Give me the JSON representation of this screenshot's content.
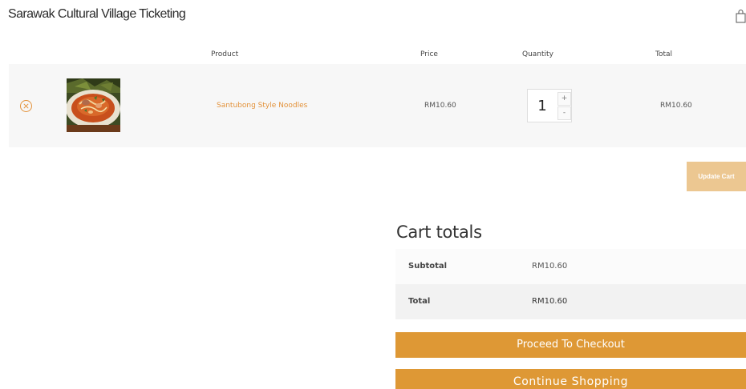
{
  "header": {
    "site_title": "Sarawak Cultural Village Ticketing",
    "cart_icon": "shopping-bag-icon"
  },
  "cart_table": {
    "columns": [
      "Product",
      "Price",
      "Quantity",
      "Total"
    ],
    "items": [
      {
        "name": "Santubong Style Noodles",
        "price": "RM10.60",
        "quantity": "1",
        "total": "RM10.60",
        "thumbnail_icon": "noodle-dish-photo",
        "remove_icon": "remove-circle-icon"
      }
    ],
    "qty_plus_label": "+",
    "qty_minus_label": "-",
    "update_label": "Update Cart"
  },
  "cart_totals": {
    "heading": "Cart totals",
    "rows": [
      {
        "label": "Subtotal",
        "value": "RM10.60"
      },
      {
        "label": "Total",
        "value": "RM10.60"
      }
    ]
  },
  "actions": {
    "checkout_label": "Proceed To Checkout",
    "continue_label": "Continue Shopping"
  },
  "colors": {
    "accent": "#de9835",
    "accent_light": "#ecc791",
    "link": "#e3923a",
    "row_background": "#f7f7f7"
  }
}
